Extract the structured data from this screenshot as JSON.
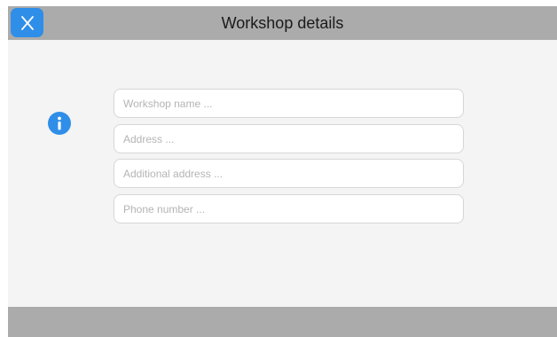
{
  "header": {
    "title": "Workshop details",
    "close_label": "X"
  },
  "form": {
    "fields": [
      {
        "placeholder": "Workshop name ...",
        "value": ""
      },
      {
        "placeholder": "Address ...",
        "value": ""
      },
      {
        "placeholder": "Additional address ...",
        "value": ""
      },
      {
        "placeholder": "Phone number ...",
        "value": ""
      }
    ]
  },
  "colors": {
    "accent": "#2f8ee8",
    "bar": "#ababab",
    "panel": "#f4f4f4"
  },
  "icons": {
    "close": "close-icon",
    "info": "info-icon"
  }
}
